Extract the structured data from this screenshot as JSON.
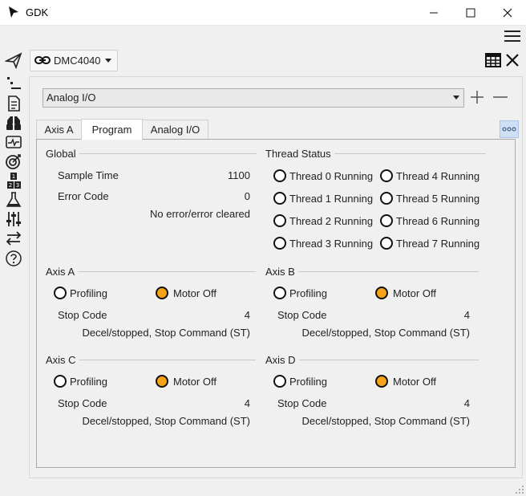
{
  "app": {
    "title": "GDK"
  },
  "connection": {
    "label": "DMC4040"
  },
  "view_select": {
    "value": "Analog I/O"
  },
  "tabs": [
    {
      "label": "Axis A"
    },
    {
      "label": "Program"
    },
    {
      "label": "Analog I/O"
    }
  ],
  "global": {
    "title": "Global",
    "sample_time_label": "Sample Time",
    "sample_time_value": "1100",
    "error_code_label": "Error Code",
    "error_code_value": "0",
    "error_text": "No error/error cleared"
  },
  "thread_status": {
    "title": "Thread Status",
    "threads": [
      "Thread 0 Running",
      "Thread 1 Running",
      "Thread 2 Running",
      "Thread 3 Running",
      "Thread 4 Running",
      "Thread 5 Running",
      "Thread 6 Running",
      "Thread 7 Running"
    ]
  },
  "axes": [
    {
      "title": "Axis A",
      "profiling": "Profiling",
      "motor_off": "Motor Off",
      "stop_code_label": "Stop Code",
      "stop_code_value": "4",
      "stop_text": "Decel/stopped, Stop Command (ST)"
    },
    {
      "title": "Axis B",
      "profiling": "Profiling",
      "motor_off": "Motor Off",
      "stop_code_label": "Stop Code",
      "stop_code_value": "4",
      "stop_text": "Decel/stopped, Stop Command (ST)"
    },
    {
      "title": "Axis C",
      "profiling": "Profiling",
      "motor_off": "Motor Off",
      "stop_code_label": "Stop Code",
      "stop_code_value": "4",
      "stop_text": "Decel/stopped, Stop Command (ST)"
    },
    {
      "title": "Axis D",
      "profiling": "Profiling",
      "motor_off": "Motor Off",
      "stop_code_label": "Stop Code",
      "stop_code_value": "4",
      "stop_text": "Decel/stopped, Stop Command (ST)"
    }
  ],
  "colors": {
    "led_on": "#f5a31a",
    "led_off": "#ffffff"
  }
}
